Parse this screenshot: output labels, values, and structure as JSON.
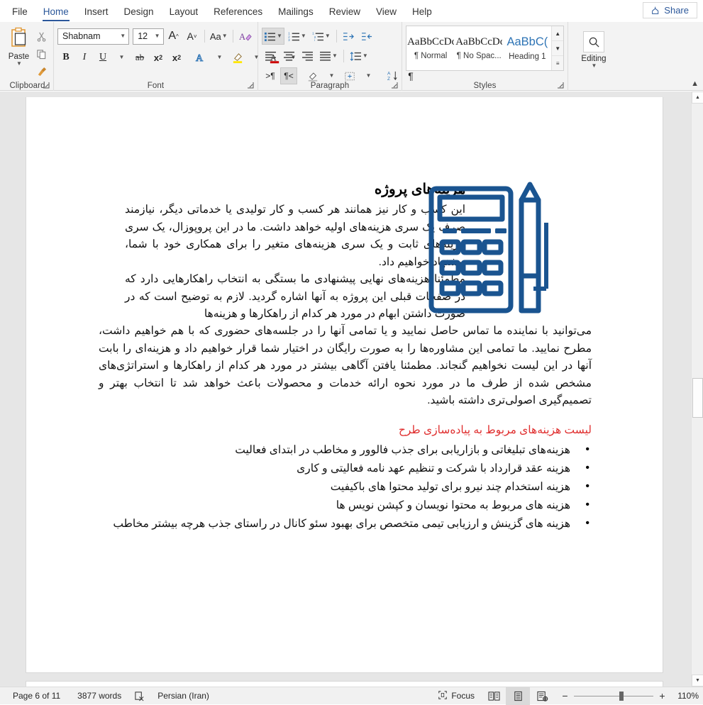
{
  "tabs": [
    {
      "label": "File",
      "active": false
    },
    {
      "label": "Home",
      "active": true
    },
    {
      "label": "Insert",
      "active": false
    },
    {
      "label": "Design",
      "active": false
    },
    {
      "label": "Layout",
      "active": false
    },
    {
      "label": "References",
      "active": false
    },
    {
      "label": "Mailings",
      "active": false
    },
    {
      "label": "Review",
      "active": false
    },
    {
      "label": "View",
      "active": false
    },
    {
      "label": "Help",
      "active": false
    }
  ],
  "share": {
    "label": "Share",
    "icon": "share-icon",
    "color": "#2b579a"
  },
  "ribbon": {
    "collapse_icon": "chevron-up-icon",
    "groups": {
      "clipboard": {
        "label": "Clipboard",
        "paste_label": "Paste",
        "paste_icon": "paste-icon",
        "cut_icon": "scissors-icon",
        "copy_icon": "copy-icon",
        "format_painter_icon": "format-painter-icon",
        "launcher_icon": "dialog-launcher-icon"
      },
      "font": {
        "label": "Font",
        "font_name": "Shabnam",
        "font_size": "12",
        "grow_font_icon": "grow-font-icon",
        "shrink_font_icon": "shrink-font-icon",
        "change_case_icon": "change-case-icon",
        "clear_formatting_icon": "clear-formatting-icon",
        "bold": "B",
        "italic": "I",
        "underline": "U",
        "strikethrough_icon": "strikethrough-icon",
        "subscript_icon": "subscript-icon",
        "superscript_icon": "superscript-icon",
        "text_effects_icon": "text-effects-icon",
        "highlight_icon": "text-highlight-icon",
        "font_color_icon": "font-color-icon",
        "launcher_icon": "dialog-launcher-icon"
      },
      "paragraph": {
        "label": "Paragraph",
        "bullets_icon": "bullet-list-icon",
        "numbering_icon": "numbered-list-icon",
        "multilevel_icon": "multilevel-list-icon",
        "decrease_indent_icon": "decrease-indent-icon",
        "increase_indent_icon": "increase-indent-icon",
        "align_left_icon": "align-left-icon",
        "align_center_icon": "align-center-icon",
        "align_right_icon": "align-right-icon",
        "justify_icon": "justify-icon",
        "line_spacing_icon": "line-spacing-icon",
        "ltr_icon": "left-to-right-icon",
        "rtl_icon": "right-to-left-icon",
        "shading_icon": "shading-icon",
        "borders_icon": "borders-icon",
        "sort_icon": "sort-icon",
        "show_marks_icon": "show-formatting-marks-icon",
        "launcher_icon": "dialog-launcher-icon"
      },
      "styles": {
        "label": "Styles",
        "items": [
          {
            "preview": "AaBbCcDc",
            "name": "¶ Normal"
          },
          {
            "preview": "AaBbCcDc",
            "name": "¶ No Spac..."
          },
          {
            "preview": "AaBbC(",
            "name": "Heading 1"
          }
        ],
        "scroll_up_icon": "scroll-up-icon",
        "scroll_down_icon": "scroll-down-icon",
        "more_styles_icon": "more-styles-icon",
        "launcher_icon": "dialog-launcher-icon"
      },
      "editing": {
        "label": "Editing",
        "icon": "search-icon",
        "caret_icon": "chevron-down-icon"
      }
    }
  },
  "document": {
    "heading": "هزینه‌های پروژه",
    "paragraph_a": "این کسب و کار نیز همانند هر کسب و کار تولیدی یا خدماتی دیگر، نیازمند صرف یک سری هزینه‌های اولیه خواهد داشت. ما در این پروپوزال، یک سری هزینه‌های ثابت و یک سری هزینه‌های متغیر را برای همکاری خود با شما، پیشنهاد خواهیم داد.",
    "paragraph_b": "مطمئنا هزینه‌های نهایی پیشنهادی ما بستگی به انتخاب راهکارهایی دارد که در صفحات قبلی این پروژه به آنها اشاره گردید. لازم به توضیح است که در صورت داشتن ابهام در مورد هر کدام از راهکارها و هزینه‌ها",
    "paragraph_c": "می‌توانید با نماینده ما تماس حاصل نمایید و یا تمامی آنها را در جلسه‌های حضوری که با هم خواهیم داشت، مطرح نمایید. ما تمامی این مشاوره‌ها را به صورت رایگان در اختیار شما قرار خواهیم داد و هزینه‌ای را بابت آنها در این لیست نخواهیم گنجاند. مطمئنا یافتن آگاهی بیشتر در مورد هر کدام از راهکارها و استراتژی‌های مشخص شده از طرف ما در مورد نحوه ارائه خدمات و محصولات باعث خواهد شد تا انتخاب بهتر و تصمیم‌گیری اصولی‌تری داشته باشید.",
    "red_heading": "لیست هزینه‌های مربوط به پیاده‌سازی طرح",
    "red_heading_color": "#e03030",
    "bullets": [
      "هزینه‌های تبلیغاتی و بازاریابی برای جذب فالوور و مخاطب در ابتدای فعالیت",
      "هزینه عقد قرارداد با شرکت و تنظیم عهد نامه فعالیتی و کاری",
      "هزینه استخدام چند نیرو برای تولید محتوا های باکیفیت",
      "هزینه های مربوط به محتوا نویسان و کپشن نویس ها",
      "هزینه های گزینش و ارزیابی تیمی متخصص برای بهبود سئو کانال در راستای جذب هرچه بیشتر مخاطب"
    ],
    "artwork": {
      "name": "calculator-and-pencil-illustration",
      "color": "#1a5490"
    }
  },
  "statusbar": {
    "page": "Page 6 of 11",
    "words": "3877 words",
    "proofing_icon": "proofing-errors-icon",
    "language": "Persian (Iran)",
    "focus_label": "Focus",
    "focus_icon": "focus-mode-icon",
    "read_mode_icon": "read-mode-icon",
    "print_layout_icon": "print-layout-icon",
    "web_layout_icon": "web-layout-icon",
    "zoom_out_icon": "−",
    "zoom_in_icon": "+",
    "zoom_value": "110%"
  },
  "scrollbar": {
    "up_icon": "scroll-up-arrow",
    "down_icon": "scroll-down-arrow",
    "thumb": "vertical-scroll-thumb"
  }
}
